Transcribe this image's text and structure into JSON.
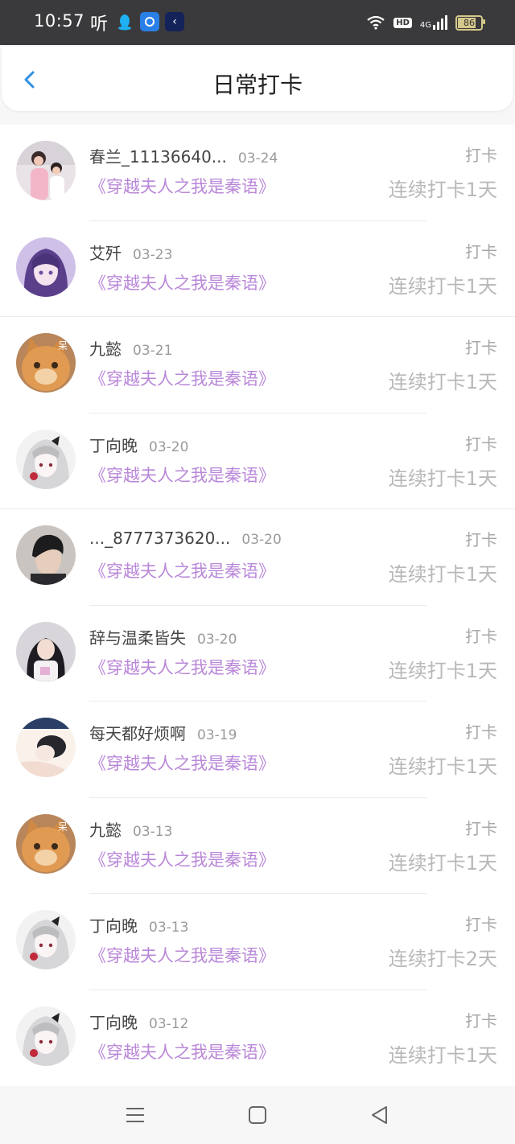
{
  "status_bar": {
    "time": "10:57",
    "ting_glyph": "听",
    "apps": [
      "qq-icon",
      "browser-icon",
      "kapp-icon"
    ],
    "network": "4G",
    "hd": "HD",
    "battery": "86"
  },
  "header": {
    "back_icon": "chevron-left-icon",
    "title": "日常打卡",
    "accent_color": "#2e8fe0"
  },
  "records": [
    {
      "name": "春兰_11136640...",
      "date": "03-24",
      "book": "《穿越夫人之我是秦语》",
      "action": "打卡",
      "streak": "连续打卡1天"
    },
    {
      "name": "艾歼",
      "date": "03-23",
      "book": "《穿越夫人之我是秦语》",
      "action": "打卡",
      "streak": "连续打卡1天"
    },
    {
      "name": "九懿",
      "date": "03-21",
      "book": "《穿越夫人之我是秦语》",
      "action": "打卡",
      "streak": "连续打卡1天"
    },
    {
      "name": "丁向晚",
      "date": "03-20",
      "book": "《穿越夫人之我是秦语》",
      "action": "打卡",
      "streak": "连续打卡1天"
    },
    {
      "name": "..._8777373620...",
      "date": "03-20",
      "book": "《穿越夫人之我是秦语》",
      "action": "打卡",
      "streak": "连续打卡1天"
    },
    {
      "name": "辞与温柔皆失",
      "date": "03-20",
      "book": "《穿越夫人之我是秦语》",
      "action": "打卡",
      "streak": "连续打卡1天"
    },
    {
      "name": "每天都好烦啊",
      "date": "03-19",
      "book": "《穿越夫人之我是秦语》",
      "action": "打卡",
      "streak": "连续打卡1天"
    },
    {
      "name": "九懿",
      "date": "03-13",
      "book": "《穿越夫人之我是秦语》",
      "action": "打卡",
      "streak": "连续打卡1天"
    },
    {
      "name": "丁向晚",
      "date": "03-13",
      "book": "《穿越夫人之我是秦语》",
      "action": "打卡",
      "streak": "连续打卡2天"
    },
    {
      "name": "丁向晚",
      "date": "03-12",
      "book": "《穿越夫人之我是秦语》",
      "action": "打卡",
      "streak": "连续打卡1天"
    }
  ],
  "nav_bar": [
    "menu-icon",
    "home-icon",
    "back-triangle-icon"
  ]
}
